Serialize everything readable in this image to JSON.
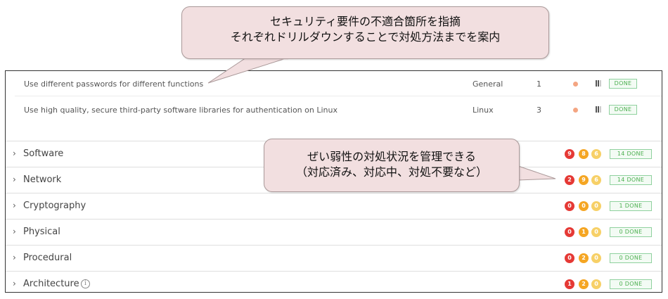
{
  "requirements": [
    {
      "text": "Use different passwords for different functions",
      "category": "General",
      "count": "1",
      "status": "DONE"
    },
    {
      "text": "Use high quality, secure third-party software libraries for authentication on Linux",
      "category": "Linux",
      "count": "3",
      "status": "DONE"
    }
  ],
  "categories": [
    {
      "label": "Software",
      "red": "9",
      "orange": "8",
      "yellow": "6",
      "done": "14 DONE"
    },
    {
      "label": "Network",
      "red": "2",
      "orange": "9",
      "yellow": "6",
      "done": "14 DONE"
    },
    {
      "label": "Cryptography",
      "red": "0",
      "orange": "0",
      "yellow": "0",
      "done": "1 DONE"
    },
    {
      "label": "Physical",
      "red": "0",
      "orange": "1",
      "yellow": "0",
      "done": "0 DONE"
    },
    {
      "label": "Procedural",
      "red": "0",
      "orange": "2",
      "yellow": "0",
      "done": "0 DONE"
    },
    {
      "label": "Architecture",
      "red": "1",
      "orange": "2",
      "yellow": "0",
      "done": "0 DONE"
    }
  ],
  "icons": {
    "expand": "chevron-right-icon",
    "info": "info-icon"
  },
  "colors": {
    "critical": "#e53935",
    "high": "#f5a623",
    "medium": "#f7d067",
    "done": "#4caf50",
    "callout_bg": "#f2dfe0"
  },
  "callouts": {
    "top": {
      "line1": "セキュリティ要件の不適合箇所を指摘",
      "line2": "それぞれドリルダウンすることで対処方法までを案内"
    },
    "middle": {
      "line1": "ぜい弱性の対処状況を管理できる",
      "line2": "（対応済み、対応中、対処不要など）"
    }
  }
}
